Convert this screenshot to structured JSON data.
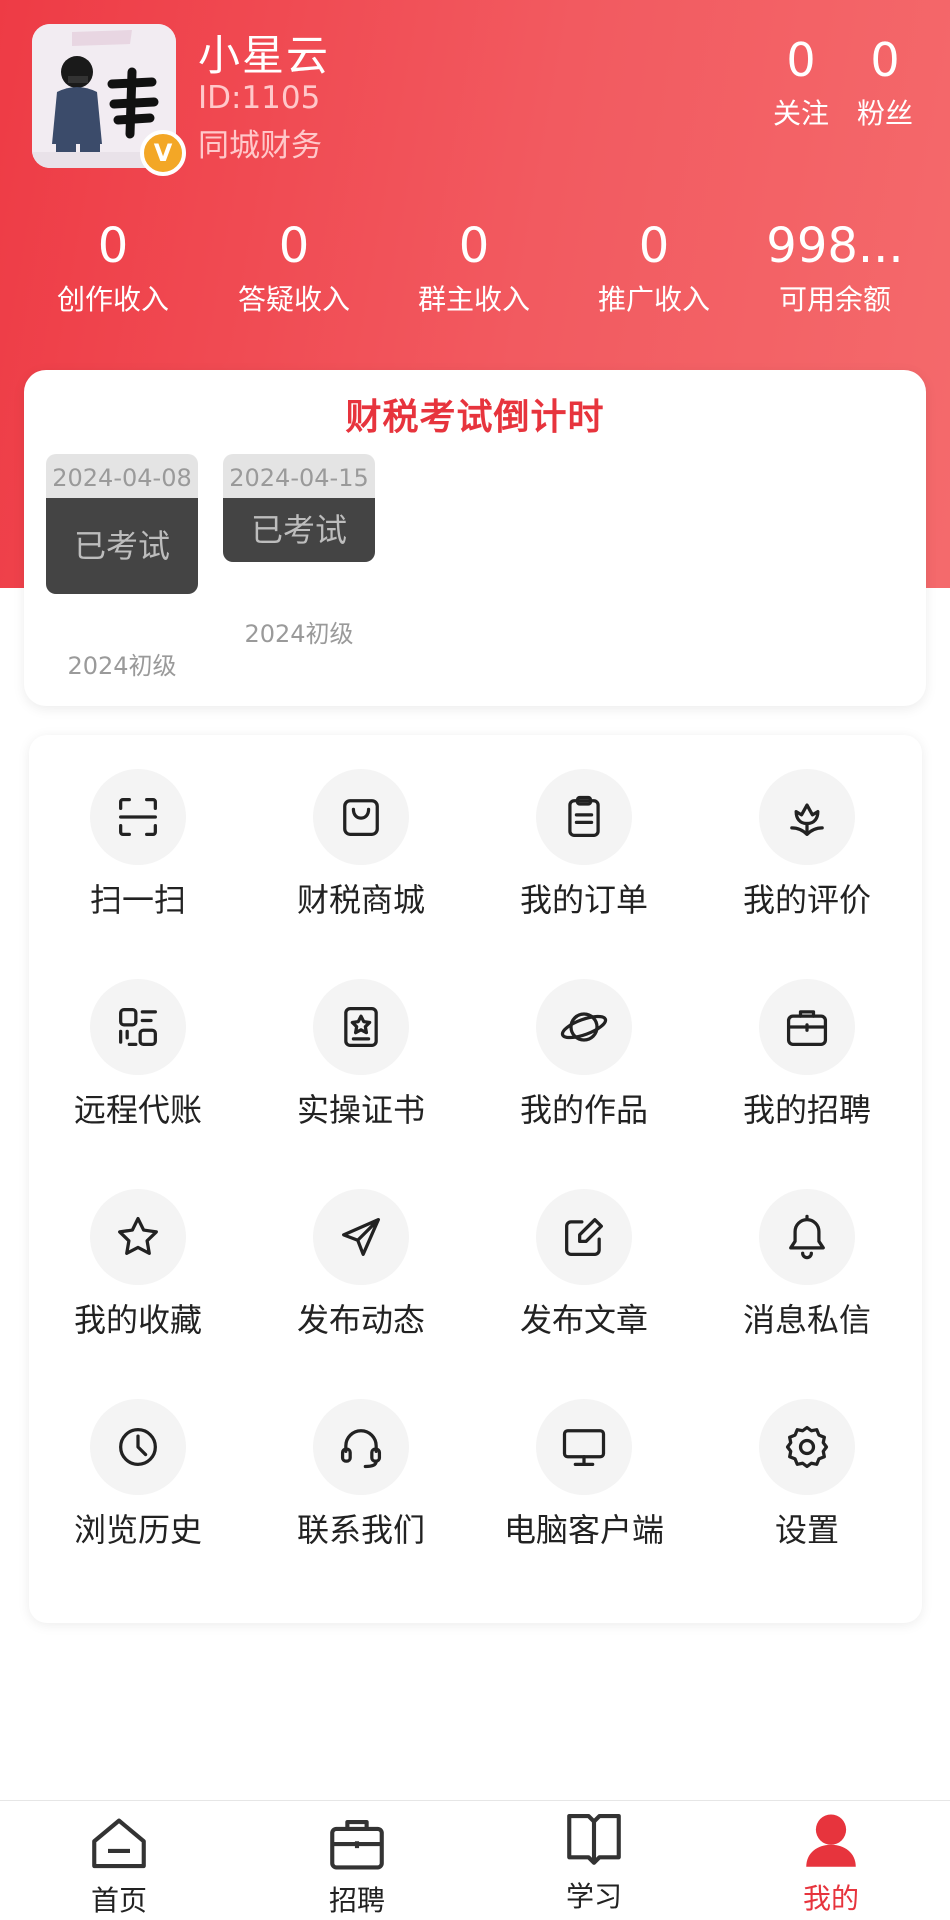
{
  "profile": {
    "name": "小星云",
    "id_text": "ID:1105",
    "org": "同城财务",
    "avatar_badge": "V",
    "following": {
      "count": "0",
      "label": "关注"
    },
    "followers": {
      "count": "0",
      "label": "粉丝"
    }
  },
  "stats": [
    {
      "value": "0",
      "label": "创作收入"
    },
    {
      "value": "0",
      "label": "答疑收入"
    },
    {
      "value": "0",
      "label": "群主收入"
    },
    {
      "value": "0",
      "label": "推广收入"
    },
    {
      "value": "998...",
      "label": "可用余额"
    }
  ],
  "countdown": {
    "title": "财税考试倒计时",
    "exams": [
      {
        "date": "2024-04-08",
        "status": "已考试",
        "level": "2024初级"
      },
      {
        "date": "2024-04-15",
        "status": "已考试",
        "level": "2024初级"
      }
    ]
  },
  "menu": {
    "items": [
      {
        "label": "扫一扫",
        "icon": "scan-icon"
      },
      {
        "label": "财税商城",
        "icon": "shopping-bag-icon"
      },
      {
        "label": "我的订单",
        "icon": "clipboard-icon"
      },
      {
        "label": "我的评价",
        "icon": "flower-icon"
      },
      {
        "label": "远程代账",
        "icon": "remote-icon"
      },
      {
        "label": "实操证书",
        "icon": "certificate-icon"
      },
      {
        "label": "我的作品",
        "icon": "planet-icon"
      },
      {
        "label": "我的招聘",
        "icon": "briefcase-icon"
      },
      {
        "label": "我的收藏",
        "icon": "star-icon"
      },
      {
        "label": "发布动态",
        "icon": "send-icon"
      },
      {
        "label": "发布文章",
        "icon": "edit-icon"
      },
      {
        "label": "消息私信",
        "icon": "bell-icon"
      },
      {
        "label": "浏览历史",
        "icon": "clock-icon"
      },
      {
        "label": "联系我们",
        "icon": "headset-icon"
      },
      {
        "label": "电脑客户端",
        "icon": "monitor-icon"
      },
      {
        "label": "设置",
        "icon": "gear-icon"
      }
    ]
  },
  "nav": {
    "items": [
      {
        "label": "首页",
        "icon": "home-icon"
      },
      {
        "label": "招聘",
        "icon": "briefcase-icon"
      },
      {
        "label": "学习",
        "icon": "book-icon"
      },
      {
        "label": "我的",
        "icon": "user-icon"
      }
    ],
    "active_index": 3
  },
  "colors": {
    "accent": "#e7343d",
    "header": "#f25a60"
  }
}
